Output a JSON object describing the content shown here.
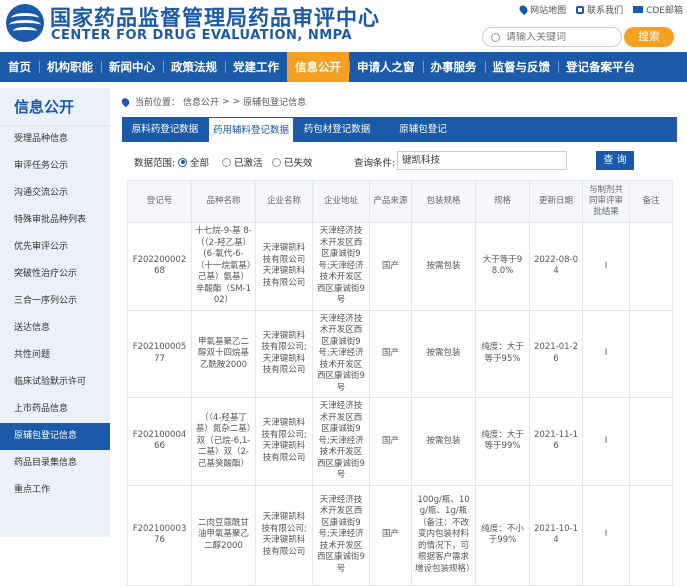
{
  "header": {
    "title_cn": "国家药品监督管理局药品审评中心",
    "title_en": "CENTER FOR DRUG EVALUATION, NMPA",
    "links": [
      {
        "label": "网站地图",
        "icon": "location-pin-icon"
      },
      {
        "label": "联系我们",
        "icon": "phone-icon"
      },
      {
        "label": "CDE邮箱",
        "icon": "mail-icon"
      }
    ],
    "search_placeholder": "请输入关键词",
    "search_button": "搜索"
  },
  "nav": {
    "items": [
      "首页",
      "机构职能",
      "新闻中心",
      "政策法规",
      "党建工作",
      "信息公开",
      "申请人之窗",
      "办事服务",
      "监督与反馈",
      "登记备案平台"
    ],
    "active_index": 5
  },
  "sidebar": {
    "title": "信息公开",
    "items": [
      "受理品种信息",
      "审评任务公示",
      "沟通交流公示",
      "特殊审批品种列表",
      "优先审评公示",
      "突破性治疗公示",
      "三合一序列公示",
      "送达信息",
      "共性问题",
      "临床试验默示许可",
      "上市药品信息",
      "原辅包登记信息",
      "药品目录集信息",
      "重点工作"
    ],
    "active_index": 11
  },
  "breadcrumb": {
    "prefix": "当前位置：",
    "path": [
      "信息公开",
      "原辅包登记信息"
    ],
    "sep": ">"
  },
  "tabs": {
    "items": [
      "原料药登记数据",
      "药用辅料登记数据",
      "药包材登记数据",
      "原辅包登记"
    ],
    "active_index": 1
  },
  "filter": {
    "scope_label": "数据范围:",
    "options": [
      "全部",
      "已激活",
      "已失效"
    ],
    "selected": 0,
    "cond_label": "查询条件:",
    "cond_value": "键凯科技",
    "query_button": "查 询"
  },
  "table": {
    "headers": [
      "登记号",
      "品种名称",
      "企业名称",
      "企业地址",
      "产品来源",
      "包装规格",
      "规格",
      "更新日期",
      "与制剂共同审评审批结果",
      "备注"
    ],
    "rows": [
      [
        "F20220000268",
        "十七烷-9-基 8-（（2-羟乙基）(6-氧代-6-（十一烷氧基）己基）氨基）辛酸酯（SM-102）",
        "天津键凯科技有限公司天津键凯科技有限公司",
        "天津经济技术开发区西区康诚街9号;天津经济技术开发区西区康诚街9号",
        "国产",
        "按需包装",
        "大于等于98.0%",
        "2022-08-04",
        "I",
        ""
      ],
      [
        "F20210000577",
        "甲氧基聚乙二醇双十四烷基乙酰胺2000",
        "天津键凯科技有限公司;天津键凯科技有限公司",
        "天津经济技术开发区西区康诚街9号;天津经济技术开发区西区康诚街9号",
        "国产",
        "按需包装",
        "纯度：大于等于95%",
        "2021-01-26",
        "I",
        ""
      ],
      [
        "F20210000466",
        "（（4-羟基丁基）氮杂二基）双（己烷-6,1-二基）双（2-己基癸酸酯）",
        "天津键凯科技有限公司;天津键凯科技有限公司",
        "天津经济技术开发区西区康诚街9号;天津经济技术开发区西区康诚街9号",
        "国产",
        "按需包装",
        "纯度：大于等于99%",
        "2021-11-16",
        "I",
        ""
      ],
      [
        "F20210000376",
        "二肉豆蔻酰甘油甲氧基聚乙二醇2000",
        "天津键凯科技有限公司;天津键凯科技有限公司",
        "天津经济技术开发区西区康诚街9号;天津经济技术开发区西区康诚街9号",
        "国产",
        "100g/瓶、10g/瓶、1g/瓶（备注：不改变内包装材料的情况下，可根据客户需求增设包装规格）",
        "纯度：不小于99%",
        "2021-10-14",
        "I",
        ""
      ]
    ]
  },
  "colors": {
    "brand_blue": "#1a5aa8",
    "accent_orange": "#f5a020",
    "sidebar_bg": "#eaf1f9"
  }
}
